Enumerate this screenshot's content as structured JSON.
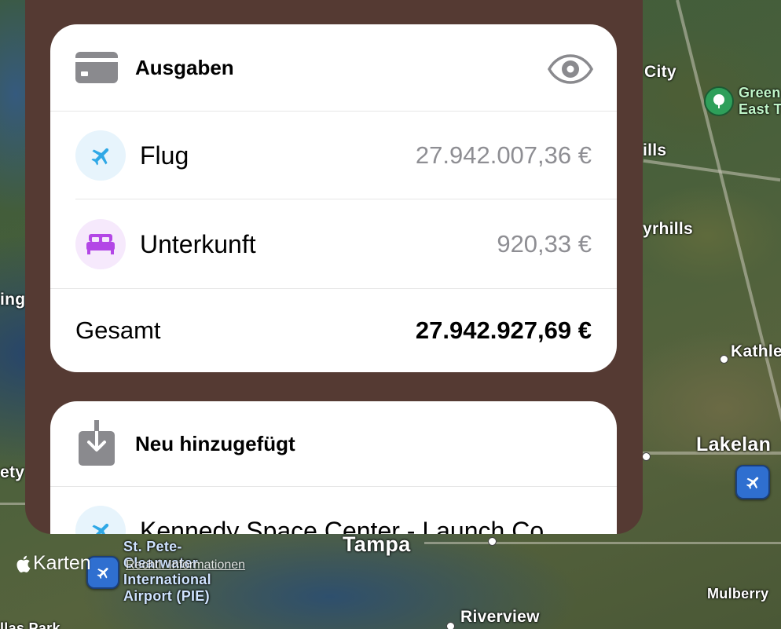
{
  "map": {
    "labels": {
      "city": "City",
      "green_east_1": "Green",
      "green_east_2": "East T",
      "ills": "ills",
      "zephyrhills": "yrhills",
      "ing": "ing",
      "kathleen": "Kathle",
      "lakeland": "Lakelan",
      "ety": "ety",
      "tampa": "Tampa",
      "pie_airport_1": "St. Pete-",
      "pie_airport_2": "Clearwater",
      "pie_airport_3": "International",
      "pie_airport_4": "Airport (PIE)",
      "riverview": "Riverview",
      "mulberry": "Mulberry",
      "dallas_park": "llas Park"
    },
    "attribution": "Karten",
    "legal_link": "Rechtl. Informationen"
  },
  "expenses": {
    "title": "Ausgaben",
    "items": [
      {
        "label": "Flug",
        "amount": "27.942.007,36 €",
        "icon": "airplane-icon",
        "color": "#2fa8e6",
        "bg": "#e7f4fc"
      },
      {
        "label": "Unterkunft",
        "amount": "920,33 €",
        "icon": "bed-icon",
        "color": "#b347e6",
        "bg": "#f6e9fc"
      }
    ],
    "total_label": "Gesamt",
    "total_amount": "27.942.927,69 €"
  },
  "recent": {
    "title": "Neu hinzugefügt",
    "items": [
      {
        "label": "Kennedy Space Center - Launch Co...",
        "icon": "airplane-icon"
      }
    ]
  },
  "colors": {
    "sheet": "#553a33",
    "card": "#ffffff",
    "secondary_text": "#8e8e93",
    "icon_gray": "#8a8a8e"
  }
}
